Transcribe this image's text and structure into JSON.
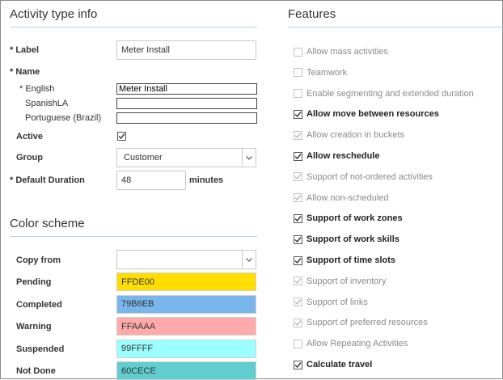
{
  "activity": {
    "title": "Activity type info",
    "label": {
      "caption": "* Label",
      "value": "Meter Install"
    },
    "name": {
      "caption": "* Name",
      "english": {
        "caption": "* English",
        "value": "Meter Install"
      },
      "spanish": {
        "caption": "SpanishLA",
        "value": ""
      },
      "portuguese": {
        "caption": "Portuguese (Brazil)",
        "value": ""
      }
    },
    "active": {
      "caption": "Active",
      "checked": true
    },
    "group": {
      "caption": "Group",
      "value": "Customer"
    },
    "duration": {
      "caption": "* Default Duration",
      "value": "48",
      "unit": "minutes"
    }
  },
  "color_scheme": {
    "title": "Color scheme",
    "copy_from": {
      "caption": "Copy from",
      "value": ""
    },
    "rows": [
      {
        "caption": "Pending",
        "value": "FFDE00",
        "color": "#FFDE00"
      },
      {
        "caption": "Completed",
        "value": "79B6EB",
        "color": "#79B6EB"
      },
      {
        "caption": "Warning",
        "value": "FFAAAA",
        "color": "#FFAAAA"
      },
      {
        "caption": "Suspended",
        "value": "99FFFF",
        "color": "#99FFFF"
      },
      {
        "caption": "Not Done",
        "value": "60CECE",
        "color": "#60CECE"
      }
    ]
  },
  "features": {
    "title": "Features",
    "items": [
      {
        "label": "Allow mass activities",
        "checked": false,
        "enabled": false
      },
      {
        "label": "Teamwork",
        "checked": false,
        "enabled": false
      },
      {
        "label": "Enable segmenting and extended duration",
        "checked": false,
        "enabled": false
      },
      {
        "label": "Allow move between resources",
        "checked": true,
        "enabled": true
      },
      {
        "label": "Allow creation in buckets",
        "checked": true,
        "enabled": false
      },
      {
        "label": "Allow reschedule",
        "checked": true,
        "enabled": true
      },
      {
        "label": "Support of not-ordered activities",
        "checked": true,
        "enabled": false
      },
      {
        "label": "Allow non-scheduled",
        "checked": true,
        "enabled": false
      },
      {
        "label": "Support of work zones",
        "checked": true,
        "enabled": true
      },
      {
        "label": "Support of work skills",
        "checked": true,
        "enabled": true
      },
      {
        "label": "Support of time slots",
        "checked": true,
        "enabled": true
      },
      {
        "label": "Support of inventory",
        "checked": true,
        "enabled": false
      },
      {
        "label": "Support of links",
        "checked": true,
        "enabled": false
      },
      {
        "label": "Support of preferred resources",
        "checked": true,
        "enabled": false
      },
      {
        "label": "Allow Repeating Activities",
        "checked": false,
        "enabled": false
      },
      {
        "label": "Calculate travel",
        "checked": true,
        "enabled": true
      }
    ]
  }
}
